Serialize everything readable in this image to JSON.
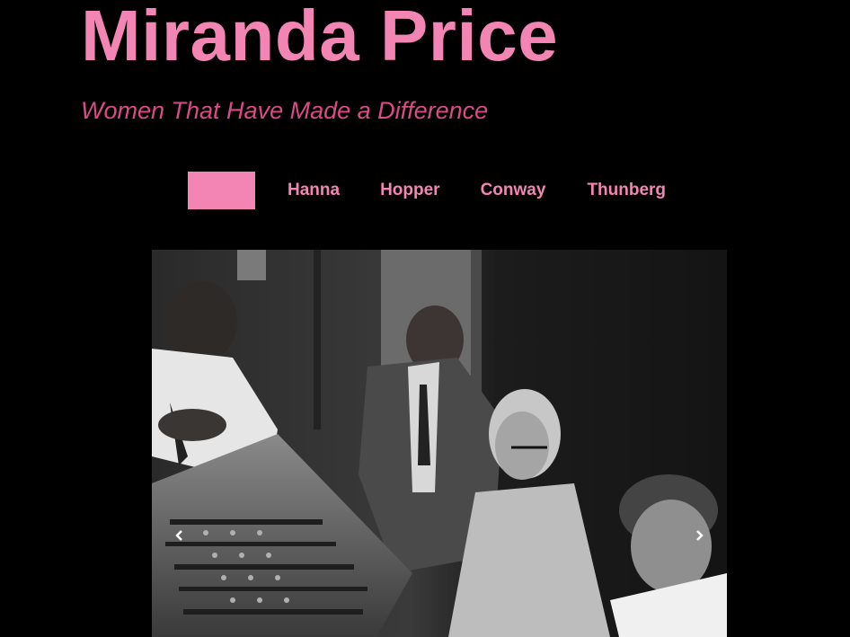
{
  "header": {
    "title": "Miranda Price",
    "tagline": "Women That Have Made a Difference"
  },
  "nav": {
    "items": [
      {
        "label": "",
        "active": true
      },
      {
        "label": "Hanna",
        "active": false
      },
      {
        "label": "Hopper",
        "active": false
      },
      {
        "label": "Conway",
        "active": false
      },
      {
        "label": "Thunberg",
        "active": false
      }
    ]
  },
  "carousel": {
    "image": "black-and-white-photo-of-people-at-computer-console",
    "prev_icon": "chevron-left-icon",
    "next_icon": "chevron-right-icon"
  },
  "colors": {
    "background": "#000000",
    "accent": "#f285b4",
    "tagline": "#d94b87",
    "control": "#ffffff"
  }
}
